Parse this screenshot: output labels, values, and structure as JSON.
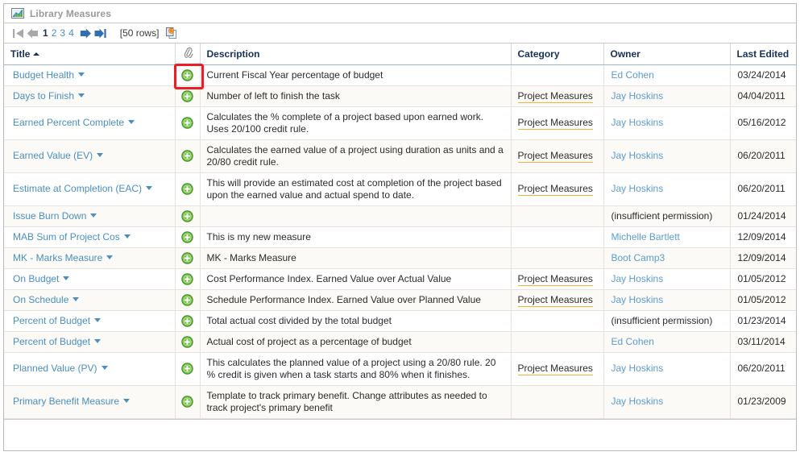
{
  "window": {
    "title": "Library Measures",
    "title_icon": "chart-icon"
  },
  "toolbar": {
    "first_label": "first-page",
    "prev_label": "previous-page",
    "next_label": "next-page",
    "last_label": "last-page",
    "pages": [
      "1",
      "2",
      "3",
      "4"
    ],
    "current_page": "1",
    "rows_label": "[50 rows]",
    "copy_icon": "copy-icon"
  },
  "grid": {
    "columns": [
      {
        "key": "title",
        "label": "Title",
        "sorted": "asc"
      },
      {
        "key": "attachment",
        "label": "",
        "icon": "paperclip-icon"
      },
      {
        "key": "description",
        "label": "Description"
      },
      {
        "key": "category",
        "label": "Category"
      },
      {
        "key": "owner",
        "label": "Owner"
      },
      {
        "key": "last_edited",
        "label": "Last Edited"
      }
    ],
    "rows": [
      {
        "title": "Budget Health",
        "attachment_icon": "add-green-plus-icon",
        "highlighted": true,
        "description": "Current Fiscal Year percentage of budget",
        "category": "",
        "owner": "Ed Cohen",
        "owner_is_link": true,
        "last_edited": "03/24/2014"
      },
      {
        "title": "Days to Finish",
        "attachment_icon": "add-green-plus-icon",
        "highlighted": false,
        "description": "Number of left to finish the task",
        "category": "Project Measures",
        "owner": "Jay Hoskins",
        "owner_is_link": true,
        "last_edited": "04/04/2011"
      },
      {
        "title": "Earned Percent Complete",
        "attachment_icon": "add-green-plus-icon",
        "highlighted": false,
        "description": "Calculates the % complete of a project based upon earned work. Uses 20/100 credit rule.",
        "category": "Project Measures",
        "owner": "Jay Hoskins",
        "owner_is_link": true,
        "last_edited": "05/16/2012"
      },
      {
        "title": "Earned Value (EV)",
        "attachment_icon": "add-green-plus-icon",
        "highlighted": false,
        "description": "Calculates the earned value of a project using duration as units and a 20/80 credit rule.",
        "category": "Project Measures",
        "owner": "Jay Hoskins",
        "owner_is_link": true,
        "last_edited": "06/20/2011"
      },
      {
        "title": "Estimate at Completion (EAC)",
        "attachment_icon": "add-green-plus-icon",
        "highlighted": false,
        "description": "This will provide an estimated cost at completion of the project based upon the earned value and actual spend to date.",
        "category": "Project Measures",
        "owner": "Jay Hoskins",
        "owner_is_link": true,
        "last_edited": "06/20/2011"
      },
      {
        "title": "Issue Burn Down",
        "attachment_icon": "add-green-plus-icon",
        "highlighted": false,
        "description": "",
        "category": "",
        "owner": "(insufficient permission)",
        "owner_is_link": false,
        "last_edited": "01/24/2014"
      },
      {
        "title": "MAB Sum of Project Cos",
        "attachment_icon": "add-green-plus-icon",
        "highlighted": false,
        "description": "This is my new measure",
        "category": "",
        "owner": "Michelle Bartlett",
        "owner_is_link": true,
        "last_edited": "12/09/2014"
      },
      {
        "title": "MK - Marks Measure",
        "attachment_icon": "add-green-plus-icon",
        "highlighted": false,
        "description": "MK - Marks Measure",
        "category": "",
        "owner": "Boot Camp3",
        "owner_is_link": true,
        "last_edited": "12/09/2014"
      },
      {
        "title": "On Budget",
        "attachment_icon": "add-green-plus-icon",
        "highlighted": false,
        "description": "Cost Performance Index. Earned Value over Actual Value",
        "category": "Project Measures",
        "owner": "Jay Hoskins",
        "owner_is_link": true,
        "last_edited": "01/05/2012"
      },
      {
        "title": "On Schedule",
        "attachment_icon": "add-green-plus-icon",
        "highlighted": false,
        "description": "Schedule Performance Index. Earned Value over Planned Value",
        "category": "Project Measures",
        "owner": "Jay Hoskins",
        "owner_is_link": true,
        "last_edited": "01/05/2012"
      },
      {
        "title": "Percent of Budget",
        "attachment_icon": "add-green-plus-icon",
        "highlighted": false,
        "description": "Total actual cost divided by the total budget",
        "category": "",
        "owner": "(insufficient permission)",
        "owner_is_link": false,
        "last_edited": "01/23/2014"
      },
      {
        "title": "Percent of Budget",
        "attachment_icon": "add-green-plus-icon",
        "highlighted": false,
        "description": "Actual cost of project as a percentage of budget",
        "category": "",
        "owner": "Ed Cohen",
        "owner_is_link": true,
        "last_edited": "03/11/2014"
      },
      {
        "title": "Planned Value (PV)",
        "attachment_icon": "add-green-plus-icon",
        "highlighted": false,
        "description": "This calculates the planned value of a project using a 20/80 rule. 20 % credit is given when a task starts and 80% when it finishes.",
        "category": "Project Measures",
        "owner": "Jay Hoskins",
        "owner_is_link": true,
        "last_edited": "06/20/2011"
      },
      {
        "title": "Primary Benefit Measure",
        "attachment_icon": "add-green-plus-icon",
        "highlighted": false,
        "description": "Template to track primary benefit. Change attributes as needed to track project's primary benefit",
        "category": "",
        "owner": "Jay Hoskins",
        "owner_is_link": true,
        "last_edited": "01/23/2009"
      }
    ]
  },
  "colors": {
    "link_blue": "#4a8ec2",
    "header_navy": "#16315a",
    "category_underline": "#f0b23a",
    "highlight_red": "#ee1c24",
    "row_alt": "#fbfaf6",
    "plus_green": "#5aa832"
  }
}
